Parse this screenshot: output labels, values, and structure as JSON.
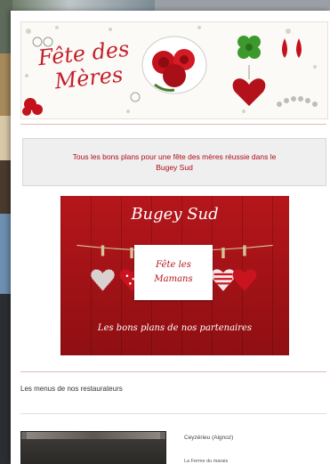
{
  "header": {
    "title_line1": "Fête des",
    "title_line2": "Mères"
  },
  "intro": {
    "text": "Tous les bons plans pour une fête des mères réussie dans le Bugey Sud"
  },
  "promo": {
    "title": "Bugey Sud",
    "card_text": "Fête les Mamans",
    "tagline": "Les bons plans de nos partenaires"
  },
  "section": {
    "title": "Les menus de nos restaurateurs"
  },
  "listing": {
    "location": "Ceyzérieu (Aignoz)",
    "name": "La Ferme du marais"
  },
  "colors": {
    "accent_red": "#c41e2a",
    "intro_text": "#b00d16",
    "promo_background": "#b5161b",
    "divider": "#e2b8b8"
  }
}
